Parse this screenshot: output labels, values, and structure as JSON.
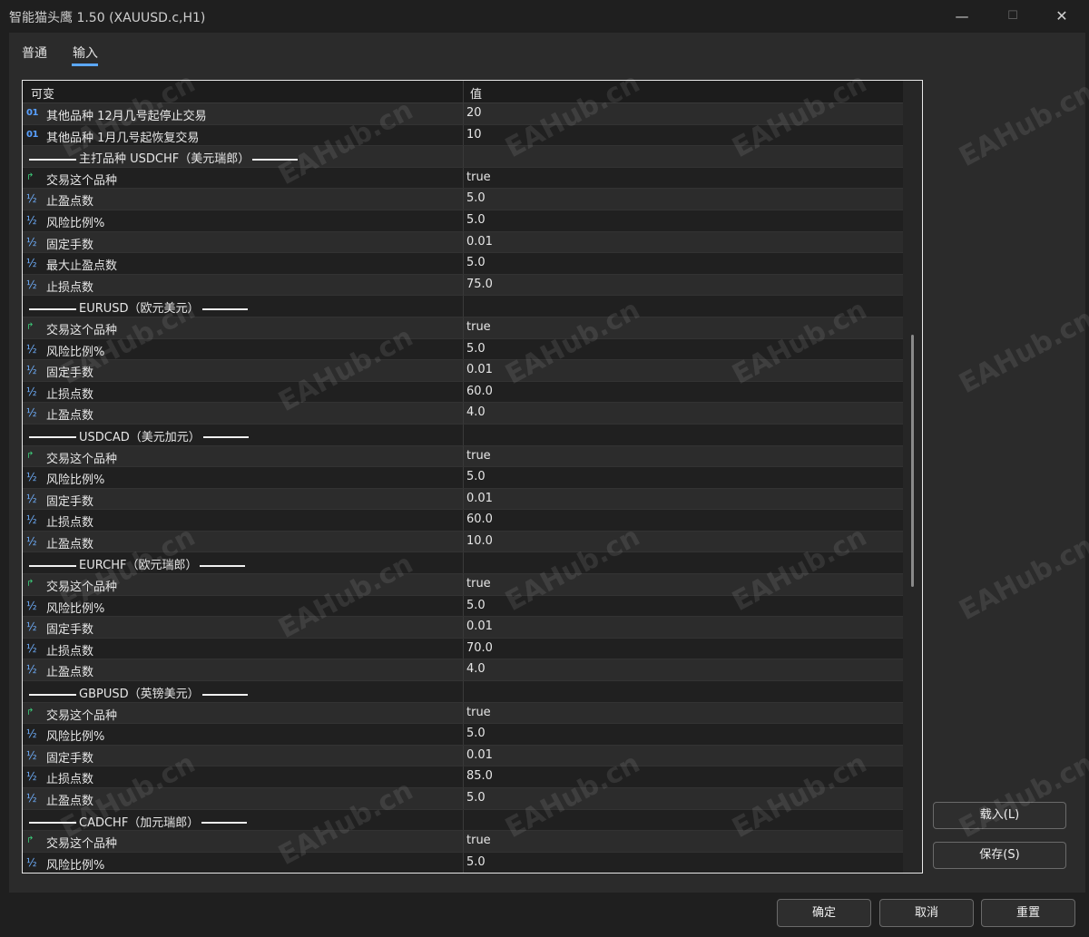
{
  "window": {
    "title": "智能猫头鹰 1.50 (XAUUSD.c,H1)",
    "min_icon": "minimize-icon",
    "max_icon": "maximize-icon",
    "close_icon": "close-icon"
  },
  "tabs": {
    "general": "普通",
    "inputs": "输入"
  },
  "table": {
    "col_variable": "可变",
    "col_value": "值"
  },
  "rows": [
    {
      "type": "int",
      "name": "其他品种 12月几号起停止交易",
      "value": "20"
    },
    {
      "type": "int",
      "name": "其他品种 1月几号起恢复交易",
      "value": "10"
    },
    {
      "type": "sep",
      "name": "主打品种 USDCHF（美元瑞郎）",
      "value": ""
    },
    {
      "type": "bool",
      "name": "交易这个品种",
      "value": "true"
    },
    {
      "type": "dbl",
      "name": "止盈点数",
      "value": "5.0"
    },
    {
      "type": "dbl",
      "name": "风险比例%",
      "value": "5.0"
    },
    {
      "type": "dbl",
      "name": "固定手数",
      "value": "0.01"
    },
    {
      "type": "dbl",
      "name": "最大止盈点数",
      "value": "5.0"
    },
    {
      "type": "dbl",
      "name": "止损点数",
      "value": "75.0"
    },
    {
      "type": "sep",
      "name": "EURUSD（欧元美元）",
      "value": ""
    },
    {
      "type": "bool",
      "name": "交易这个品种",
      "value": "true"
    },
    {
      "type": "dbl",
      "name": "风险比例%",
      "value": "5.0"
    },
    {
      "type": "dbl",
      "name": "固定手数",
      "value": "0.01"
    },
    {
      "type": "dbl",
      "name": "止损点数",
      "value": "60.0"
    },
    {
      "type": "dbl",
      "name": "止盈点数",
      "value": "4.0"
    },
    {
      "type": "sep",
      "name": "USDCAD（美元加元）",
      "value": ""
    },
    {
      "type": "bool",
      "name": "交易这个品种",
      "value": "true"
    },
    {
      "type": "dbl",
      "name": "风险比例%",
      "value": "5.0"
    },
    {
      "type": "dbl",
      "name": "固定手数",
      "value": "0.01"
    },
    {
      "type": "dbl",
      "name": "止损点数",
      "value": "60.0"
    },
    {
      "type": "dbl",
      "name": "止盈点数",
      "value": "10.0"
    },
    {
      "type": "sep",
      "name": "EURCHF（欧元瑞郎）",
      "value": ""
    },
    {
      "type": "bool",
      "name": "交易这个品种",
      "value": "true"
    },
    {
      "type": "dbl",
      "name": "风险比例%",
      "value": "5.0"
    },
    {
      "type": "dbl",
      "name": "固定手数",
      "value": "0.01"
    },
    {
      "type": "dbl",
      "name": "止损点数",
      "value": "70.0"
    },
    {
      "type": "dbl",
      "name": "止盈点数",
      "value": "4.0"
    },
    {
      "type": "sep",
      "name": "GBPUSD（英镑美元）",
      "value": ""
    },
    {
      "type": "bool",
      "name": "交易这个品种",
      "value": "true"
    },
    {
      "type": "dbl",
      "name": "风险比例%",
      "value": "5.0"
    },
    {
      "type": "dbl",
      "name": "固定手数",
      "value": "0.01"
    },
    {
      "type": "dbl",
      "name": "止损点数",
      "value": "85.0"
    },
    {
      "type": "dbl",
      "name": "止盈点数",
      "value": "5.0"
    },
    {
      "type": "sep",
      "name": "CADCHF（加元瑞郎）",
      "value": ""
    },
    {
      "type": "bool",
      "name": "交易这个品种",
      "value": "true"
    },
    {
      "type": "dbl",
      "name": "风险比例%",
      "value": "5.0"
    }
  ],
  "icons": {
    "int": "01",
    "dbl": "½",
    "bool": "↱"
  },
  "buttons": {
    "load": "载入(L)",
    "save": "保存(S)",
    "ok": "确定",
    "cancel": "取消",
    "reset": "重置"
  },
  "watermark": "EAHub.cn"
}
